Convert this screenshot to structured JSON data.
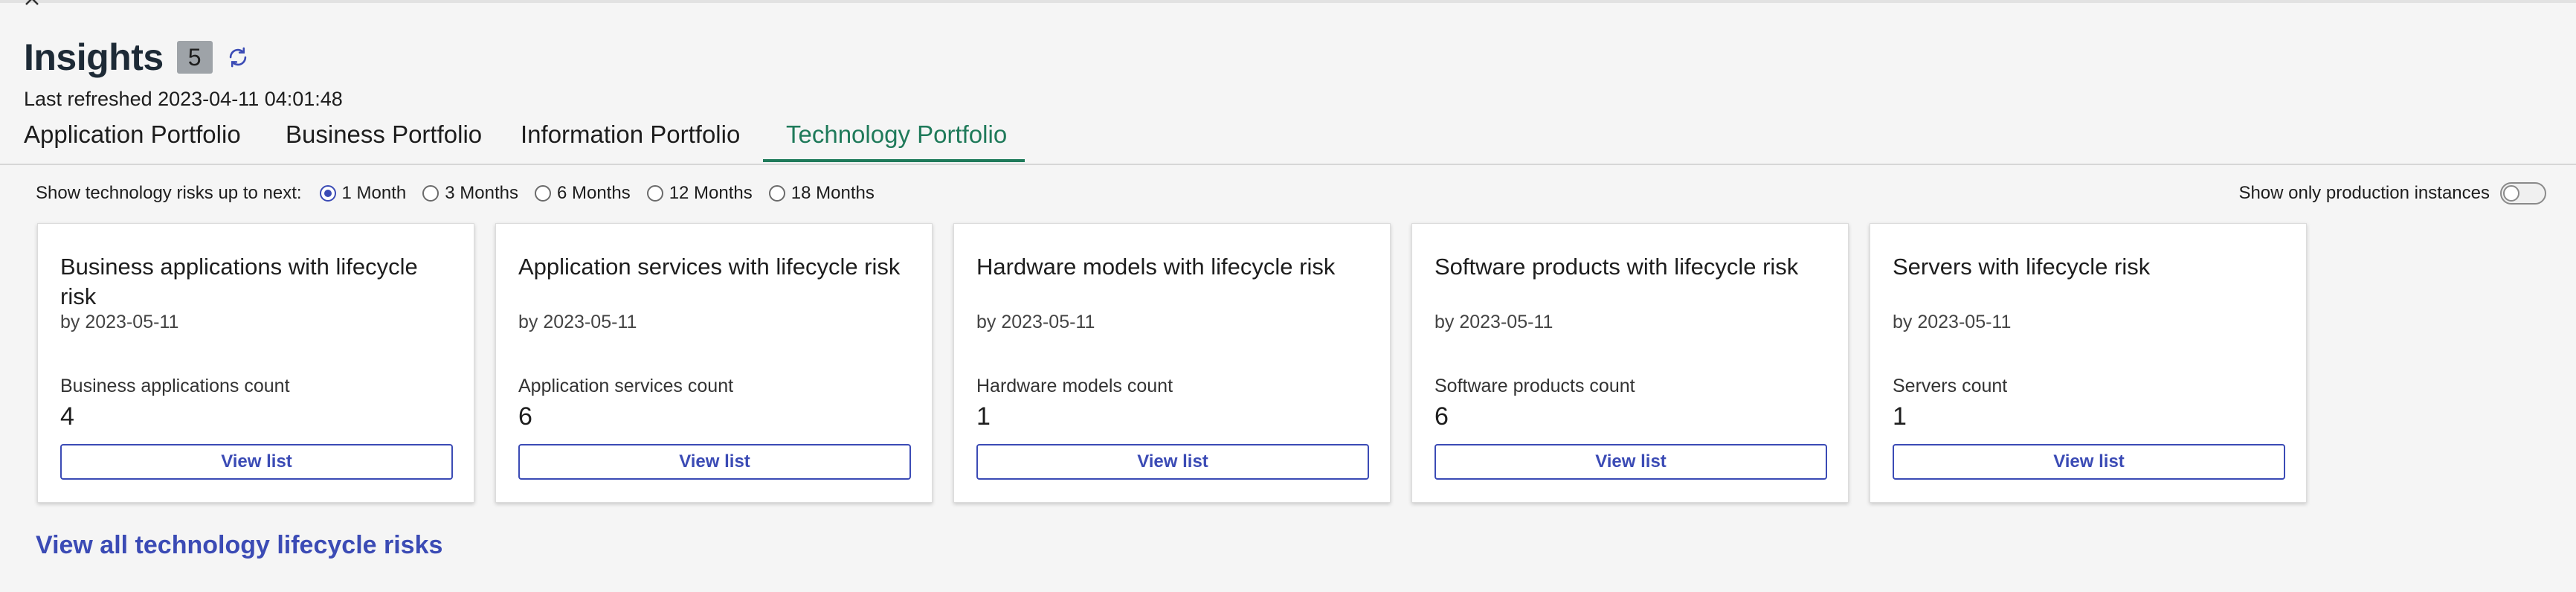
{
  "header": {
    "title": "Insights",
    "badge_count": "5",
    "last_refreshed": "Last refreshed 2023-04-11 04:01:48"
  },
  "tabs": [
    {
      "label": "Application Portfolio",
      "active": false
    },
    {
      "label": "Business Portfolio",
      "active": false
    },
    {
      "label": "Information Portfolio",
      "active": false
    },
    {
      "label": "Technology Portfolio",
      "active": true
    }
  ],
  "filters": {
    "label": "Show technology risks up to next:",
    "options": [
      "1 Month",
      "3 Months",
      "6 Months",
      "12 Months",
      "18 Months"
    ],
    "selected": "1 Month",
    "production_toggle_label": "Show only production instances",
    "production_toggle_on": false
  },
  "cards": [
    {
      "title": "Business applications with lifecycle risk",
      "date": "by 2023-05-11",
      "count_label": "Business applications count",
      "count": "4",
      "button": "View list"
    },
    {
      "title": "Application services with lifecycle risk",
      "date": "by 2023-05-11",
      "count_label": "Application services count",
      "count": "6",
      "button": "View list"
    },
    {
      "title": "Hardware models with lifecycle risk",
      "date": "by 2023-05-11",
      "count_label": "Hardware models count",
      "count": "1",
      "button": "View list"
    },
    {
      "title": "Software products with lifecycle risk",
      "date": "by 2023-05-11",
      "count_label": "Software products count",
      "count": "6",
      "button": "View list"
    },
    {
      "title": "Servers with lifecycle risk",
      "date": "by 2023-05-11",
      "count_label": "Servers count",
      "count": "1",
      "button": "View list"
    }
  ],
  "footer_link": "View all technology lifecycle risks",
  "colors": {
    "accent": "#3b4bb5",
    "active_tab": "#1f7a5a",
    "badge_bg": "#9ea3a8"
  },
  "icons": {
    "close": "close-icon",
    "refresh": "refresh-icon"
  }
}
